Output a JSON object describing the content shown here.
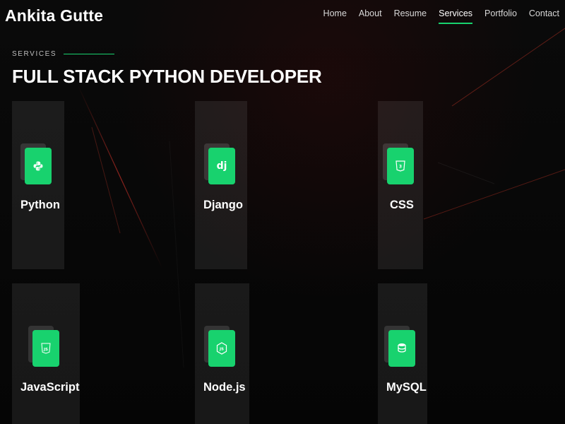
{
  "brand": {
    "name": "Ankita Gutte"
  },
  "nav": {
    "items": [
      {
        "label": "Home"
      },
      {
        "label": "About"
      },
      {
        "label": "Resume"
      },
      {
        "label": "Services",
        "active": true
      },
      {
        "label": "Portfolio"
      },
      {
        "label": "Contact"
      }
    ]
  },
  "section": {
    "eyebrow": "SERVICES",
    "title": "FULL STACK PYTHON DEVELOPER"
  },
  "services": [
    {
      "title": "Python",
      "icon": "python-icon"
    },
    {
      "title": "Django",
      "icon": "django-icon"
    },
    {
      "title": "CSS",
      "icon": "css3-icon"
    },
    {
      "title": "JavaScript",
      "icon": "javascript-icon"
    },
    {
      "title": "Node.js",
      "icon": "nodejs-icon"
    },
    {
      "title": "MySQL",
      "icon": "database-icon"
    }
  ],
  "colors": {
    "accent": "#18d26e",
    "background": "#060606",
    "card": "#1c1c1c"
  }
}
